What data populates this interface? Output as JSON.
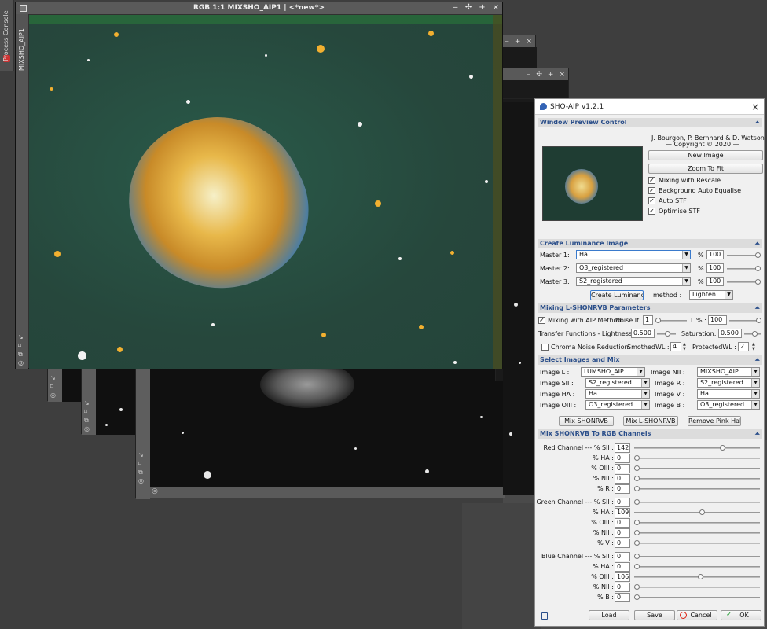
{
  "process_console": {
    "label": "Process Console"
  },
  "main_window": {
    "title": "RGB 1:1 MIXSHO_AIP1 | <*new*>",
    "side_tab": "MIXSHO_AIP1",
    "controls": [
      "‒",
      "✣",
      "+",
      "×"
    ]
  },
  "back_window_controls": [
    "‒",
    "✣",
    "+",
    "×"
  ],
  "dialog": {
    "title": "SHO-AIP v1.2.1",
    "window_preview": {
      "header": "Window Preview Control",
      "credits": "J. Bourgon, P. Bernhard & D. Watson",
      "copyright": "— Copyright © 2020 —",
      "new_image_btn": "New Image",
      "zoom_fit_btn": "Zoom To Fit",
      "checks": [
        {
          "label": "Mixing with Rescale",
          "checked": true
        },
        {
          "label": "Background Auto Equalise",
          "checked": true
        },
        {
          "label": "Auto STF",
          "checked": true
        },
        {
          "label": "Optimise STF",
          "checked": true
        }
      ]
    },
    "luminance": {
      "header": "Create Luminance Image",
      "masters": [
        {
          "label": "Master 1:",
          "value": "Ha",
          "pct_label": "%",
          "pct": "100"
        },
        {
          "label": "Master 2:",
          "value": "O3_registered",
          "pct_label": "%",
          "pct": "100"
        },
        {
          "label": "Master 3:",
          "value": "S2_registered",
          "pct_label": "%",
          "pct": "100"
        }
      ],
      "create_btn": "Create Luminance Image",
      "method_label": "method :",
      "method_value": "Lighten"
    },
    "mixing": {
      "header": "Mixing L-SHONRVB Parameters",
      "aip_label": "Mixing with AIP Method",
      "noise_label": "Noise It:",
      "noise_value": "1",
      "lpct_label": "L % :",
      "lpct_value": "100",
      "transfer_label": "Transfer Functions - Lightness:",
      "transfer_value": "0.500",
      "saturation_label": "Saturation:",
      "saturation_value": "0.500",
      "chroma_label": "Chroma Noise Reduction",
      "smoothed_label": "SmothedWL :",
      "smoothed_value": "4",
      "protected_label": "ProtectedWL :",
      "protected_value": "2"
    },
    "select": {
      "header": "Select Images and Mix",
      "rows": [
        {
          "l1": "Image L :",
          "v1": "LUMSHO_AIP",
          "l2": "Image NII :",
          "v2": "MIXSHO_AIP"
        },
        {
          "l1": "Image SII :",
          "v1": "S2_registered",
          "l2": "Image R :",
          "v2": "S2_registered"
        },
        {
          "l1": "Image HA :",
          "v1": "Ha",
          "l2": "Image V :",
          "v2": "Ha"
        },
        {
          "l1": "Image OIII :",
          "v1": "O3_registered",
          "l2": "Image B :",
          "v2": "O3_registered"
        }
      ],
      "mix_shonrvb": "Mix SHONRVB",
      "mix_lshonrvb": "Mix L-SHONRVB",
      "remove_pink": "Remove Pink Halo"
    },
    "channels": {
      "header": "Mix SHONRVB To RGB Channels",
      "red": [
        {
          "label": "Red Channel --- % SII :",
          "value": "142",
          "frac": 0.71
        },
        {
          "label": "% HA :",
          "value": "0",
          "frac": 0
        },
        {
          "label": "% OIII :",
          "value": "0",
          "frac": 0
        },
        {
          "label": "% NII :",
          "value": "0",
          "frac": 0
        },
        {
          "label": "% R :",
          "value": "0",
          "frac": 0
        }
      ],
      "green": [
        {
          "label": "Green Channel --- % SII :",
          "value": "0",
          "frac": 0
        },
        {
          "label": "% HA :",
          "value": "109",
          "frac": 0.545
        },
        {
          "label": "% OIII :",
          "value": "0",
          "frac": 0
        },
        {
          "label": "% NII :",
          "value": "0",
          "frac": 0
        },
        {
          "label": "% V :",
          "value": "0",
          "frac": 0
        }
      ],
      "blue": [
        {
          "label": "Blue Channel --- % SII :",
          "value": "0",
          "frac": 0
        },
        {
          "label": "% HA :",
          "value": "0",
          "frac": 0
        },
        {
          "label": "% OIII :",
          "value": "106",
          "frac": 0.53
        },
        {
          "label": "% NII :",
          "value": "0",
          "frac": 0
        },
        {
          "label": "% B :",
          "value": "0",
          "frac": 0
        }
      ]
    },
    "footer": {
      "load": "Load",
      "save": "Save",
      "cancel": "Cancel",
      "ok": "OK"
    }
  }
}
